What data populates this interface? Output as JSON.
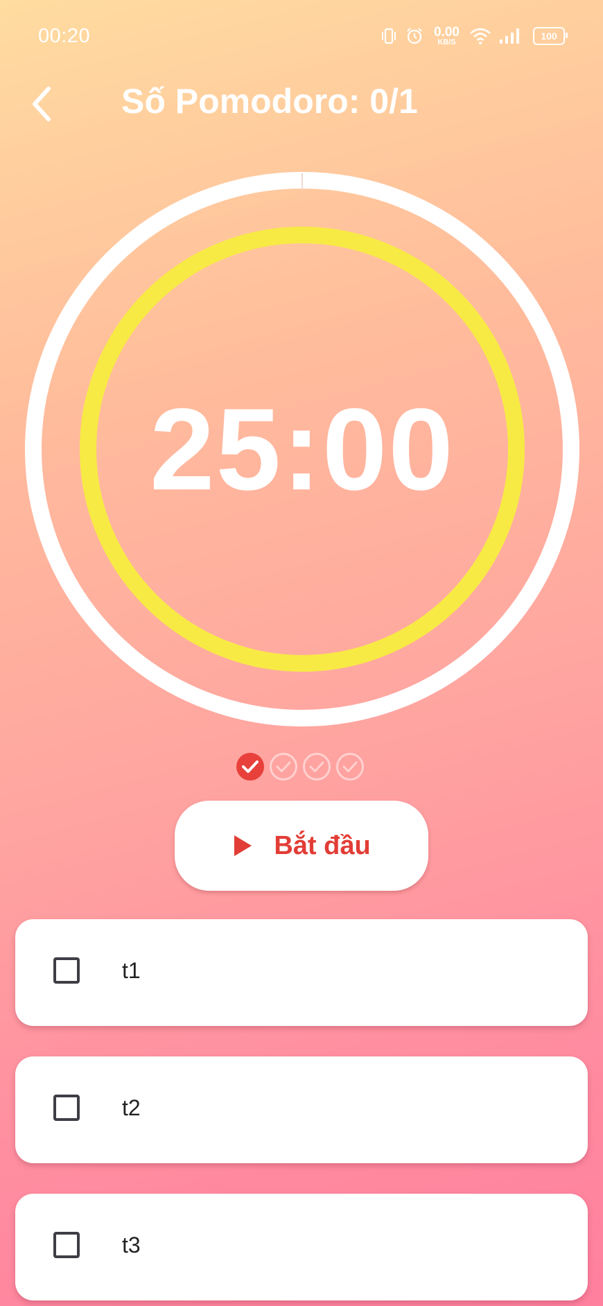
{
  "status_bar": {
    "time": "00:20",
    "net_speed_value": "0.00",
    "net_speed_unit": "KB/S",
    "battery": "100",
    "icons": [
      "vibrate-icon",
      "alarm-icon",
      "wifi-icon",
      "signal-icon",
      "battery-icon"
    ]
  },
  "header": {
    "title": "Số Pomodoro: 0/1",
    "back_icon": "chevron-left-icon"
  },
  "timer": {
    "display": "25:00",
    "progress": 0,
    "outer_ring_color": "#ffffff",
    "inner_ring_color": "#f7ea45"
  },
  "sessions": {
    "total": 4,
    "completed": 1,
    "active_color": "#e8403b"
  },
  "start_button": {
    "label": "Bắt đầu",
    "icon": "play-icon",
    "color": "#e23d36"
  },
  "tasks": [
    {
      "label": "t1",
      "checked": false
    },
    {
      "label": "t2",
      "checked": false
    },
    {
      "label": "t3",
      "checked": false
    }
  ]
}
